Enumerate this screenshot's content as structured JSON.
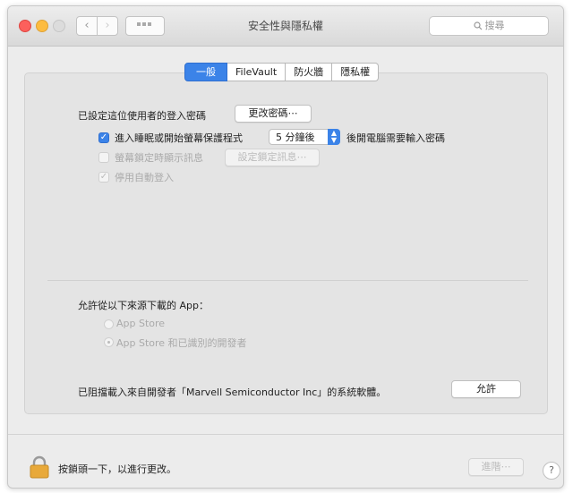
{
  "window": {
    "title": "安全性與隱私權",
    "search_placeholder": "搜尋"
  },
  "tabs": [
    {
      "label": "一般",
      "active": true
    },
    {
      "label": "FileVault",
      "active": false
    },
    {
      "label": "防火牆",
      "active": false
    },
    {
      "label": "隱私權",
      "active": false
    }
  ],
  "general": {
    "password_label": "已設定這位使用者的登入密碼",
    "change_password_button": "更改密碼⋯",
    "require_password": {
      "checked": true,
      "label_before": "進入睡眠或開始螢幕保護程式",
      "delay_value": "5 分鐘後",
      "label_after": "後開電腦需要輸入密碼"
    },
    "show_message": {
      "checked": false,
      "enabled": false,
      "label": "螢幕鎖定時顯示訊息",
      "button": "設定鎖定訊息⋯"
    },
    "disable_auto_login": {
      "checked": true,
      "enabled": false,
      "label": "停用自動登入"
    }
  },
  "downloads": {
    "heading": "允許從以下來源下載的 App：",
    "options": [
      {
        "label": "App Store",
        "selected": false
      },
      {
        "label": "App Store 和已識別的開發者",
        "selected": true
      }
    ]
  },
  "blocked_notice": {
    "text": "已阻擋載入來自開發者「Marvell Semiconductor Inc」的系統軟體。",
    "allow_button": "允許"
  },
  "footer": {
    "lock_text": "按鎖頭一下，以進行更改。",
    "apply_button": "進階⋯",
    "help": "?"
  },
  "colors": {
    "accent": "#3b83e8",
    "close": "#fc605c",
    "minimize": "#fdbc40",
    "lock": "#e8a93a"
  }
}
